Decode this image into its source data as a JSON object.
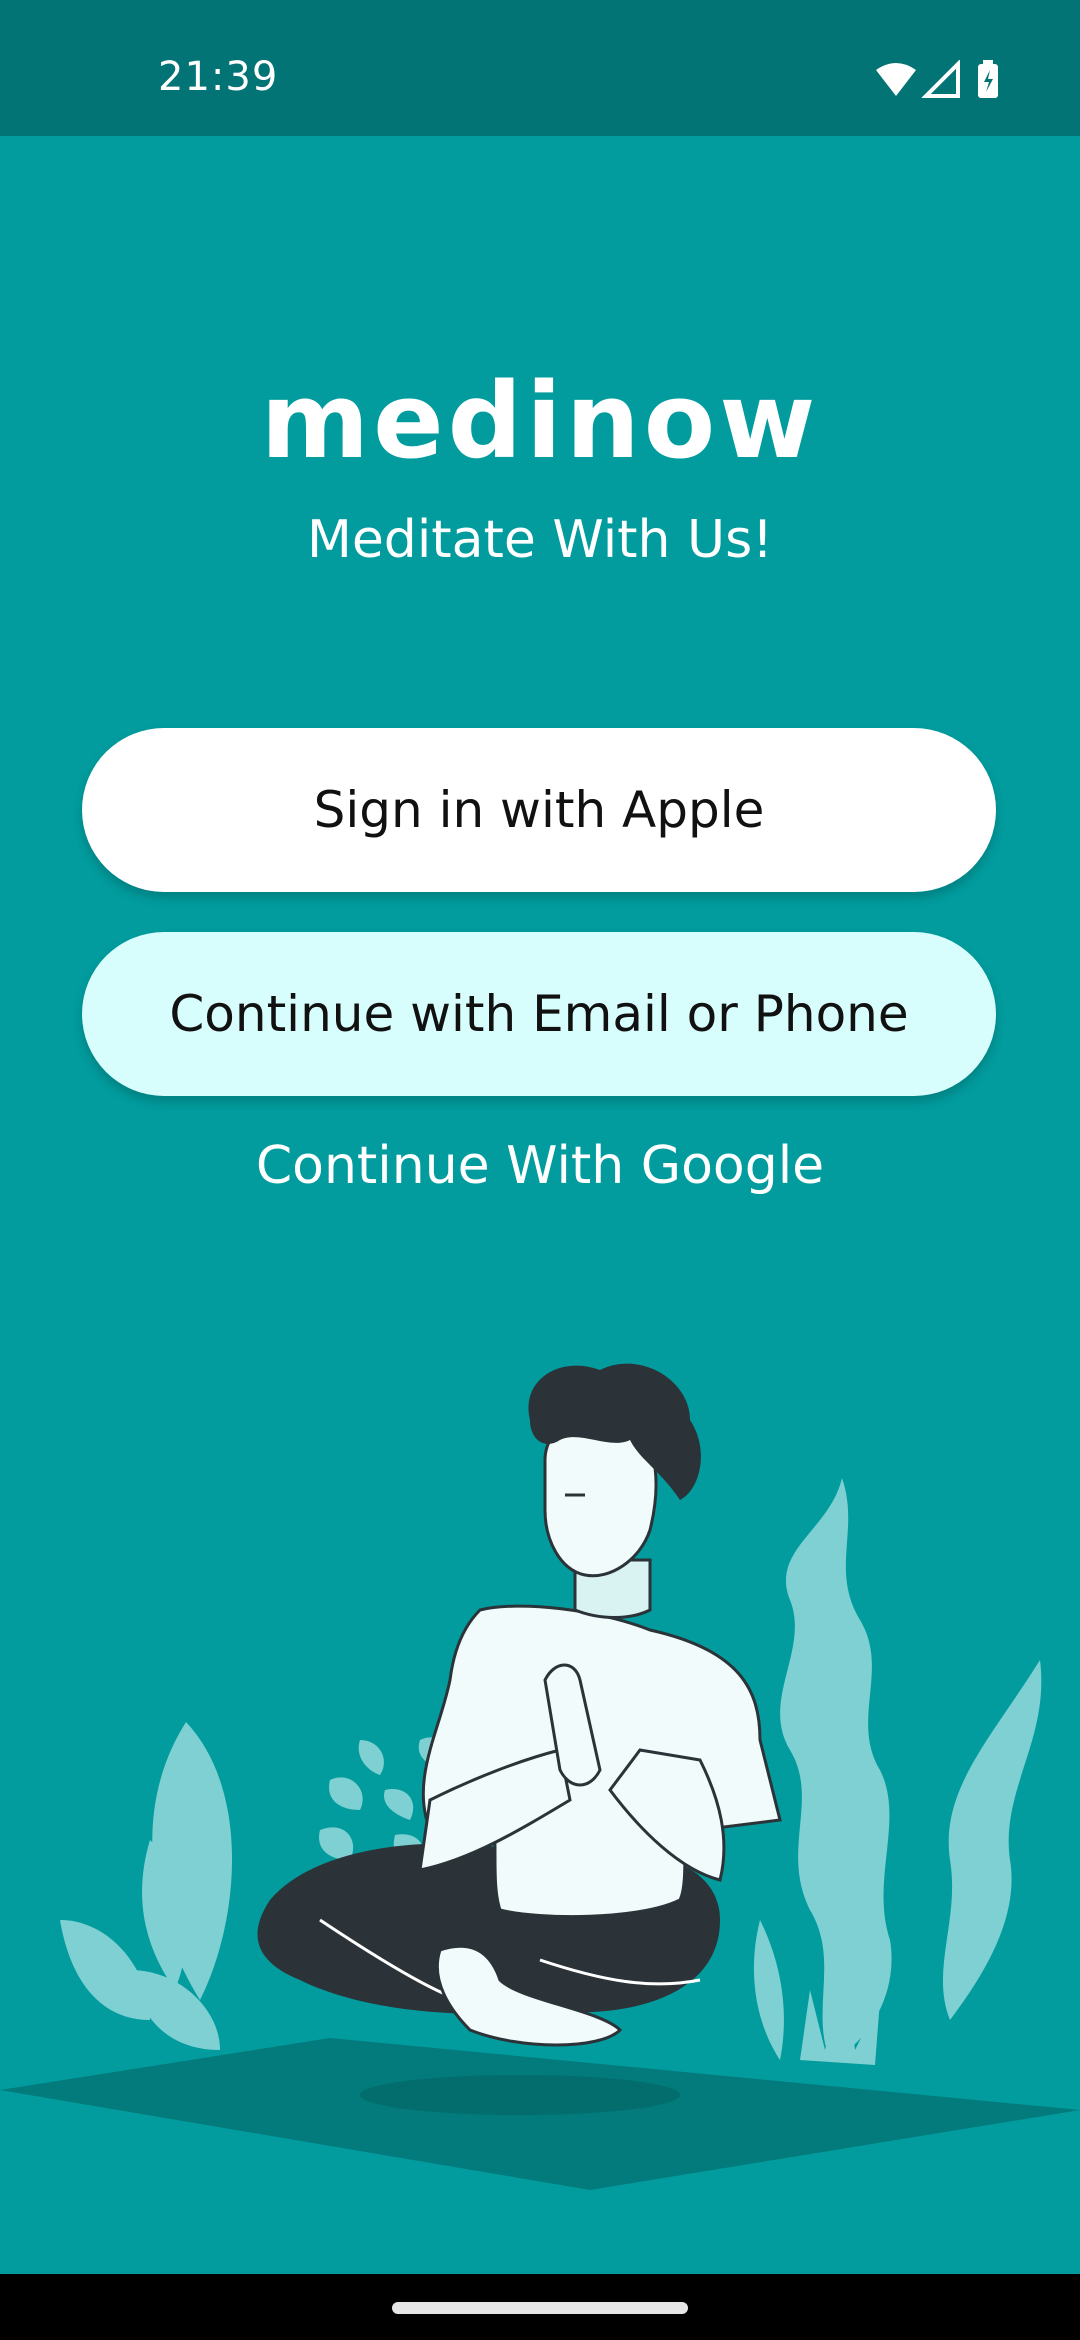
{
  "status_bar": {
    "time": "21:39",
    "icons": [
      "wifi-icon",
      "cell-signal-icon",
      "battery-charging-icon"
    ]
  },
  "app": {
    "logo_text": "medinow",
    "tagline": "Meditate With Us!"
  },
  "auth": {
    "apple_label": "Sign in with Apple",
    "email_phone_label": "Continue with Email or Phone",
    "google_label": "Continue With Google"
  },
  "colors": {
    "background": "#029c9e",
    "status_bar": "#037476",
    "primary_button": "#ffffff",
    "secondary_button": "#d8fdfd",
    "text_on_light": "#111111",
    "text_on_dark": "#ffffff"
  },
  "illustration": {
    "name": "meditating-person-illustration"
  }
}
